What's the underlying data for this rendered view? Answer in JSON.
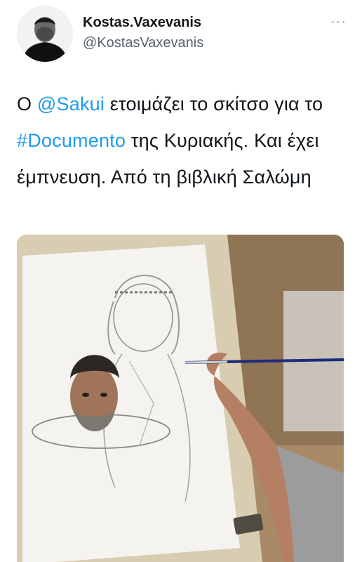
{
  "author": {
    "display_name": "Kostas.Vaxevanis",
    "handle": "@KostasVaxevanis",
    "avatar_icon": "user-avatar-photo"
  },
  "more_menu": {
    "label": "···",
    "icon": "more-horizontal-icon"
  },
  "tweet": {
    "text_parts": [
      {
        "type": "text",
        "value": "Ο "
      },
      {
        "type": "mention",
        "value": "@Sakui"
      },
      {
        "type": "text",
        "value": " ετοιμάζει το σκίτσο για το "
      },
      {
        "type": "hashtag",
        "value": "#Documento"
      },
      {
        "type": "text",
        "value": " της Κυριακής. Και έχει έμπνευση. Από τη βιβλική Σαλώμη"
      }
    ]
  },
  "media": {
    "description_icon": "photo-caricature-drawing",
    "colors": {
      "link": "#1d9bf0",
      "text": "#0f1419",
      "secondary": "#536471"
    }
  }
}
